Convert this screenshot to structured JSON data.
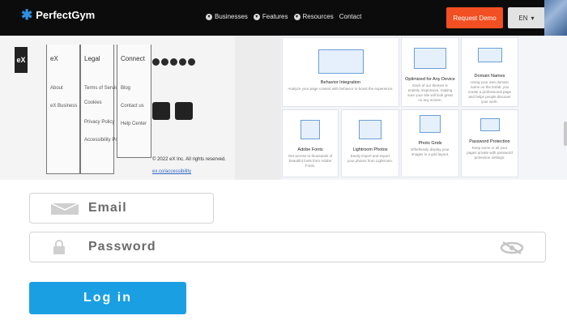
{
  "header": {
    "brand": "PerfectGym",
    "nav": [
      "Businesses",
      "Features",
      "Resources",
      "Contact"
    ],
    "demo_button": "Request Demo",
    "lang_button": "EN"
  },
  "footer": {
    "logo": "eX",
    "columns": [
      {
        "title": "eX",
        "links": [
          "About",
          "eX Business"
        ]
      },
      {
        "title": "Legal",
        "links": [
          "Terms of Service",
          "Cookies",
          "Privacy Policy",
          "Accessibility Policy"
        ]
      },
      {
        "title": "Connect",
        "links": [
          "Blog",
          "Contact us",
          "Help Center"
        ]
      }
    ],
    "copyright": "© 2022 eX Inc. All rights reserved.",
    "copyright_link": "ex.co/accessibility"
  },
  "features": [
    {
      "title": "Behavior Integration",
      "desc": "Analyze your page content with behavior to boost the experience."
    },
    {
      "title": "Optimized for Any Device",
      "desc": "Each of our themes is entirely responsive, making sure your site will look great on any screen."
    },
    {
      "title": "Domain Names",
      "desc": "Using your own domain name on the Eslab. you create a professional page and helps people discover your work."
    },
    {
      "title": "Adobe Fonts",
      "desc": "Get access to thousands of beautiful fonts from Adobe Fonts."
    },
    {
      "title": "Lightroom Photos",
      "desc": "Easily import and export your photos from Lightroom."
    },
    {
      "title": "Photo Grids",
      "desc": "Effortlessly display your images in a grid layout."
    },
    {
      "title": "Password Protection",
      "desc": "Keep some or all your pages private with password protection settings."
    }
  ],
  "form": {
    "email_placeholder": "Email",
    "password_placeholder": "Password",
    "login_button": "Log in"
  },
  "colors": {
    "accent": "#1b9fe3",
    "demo": "#f24f22",
    "topbar": "#0c0c0c"
  }
}
